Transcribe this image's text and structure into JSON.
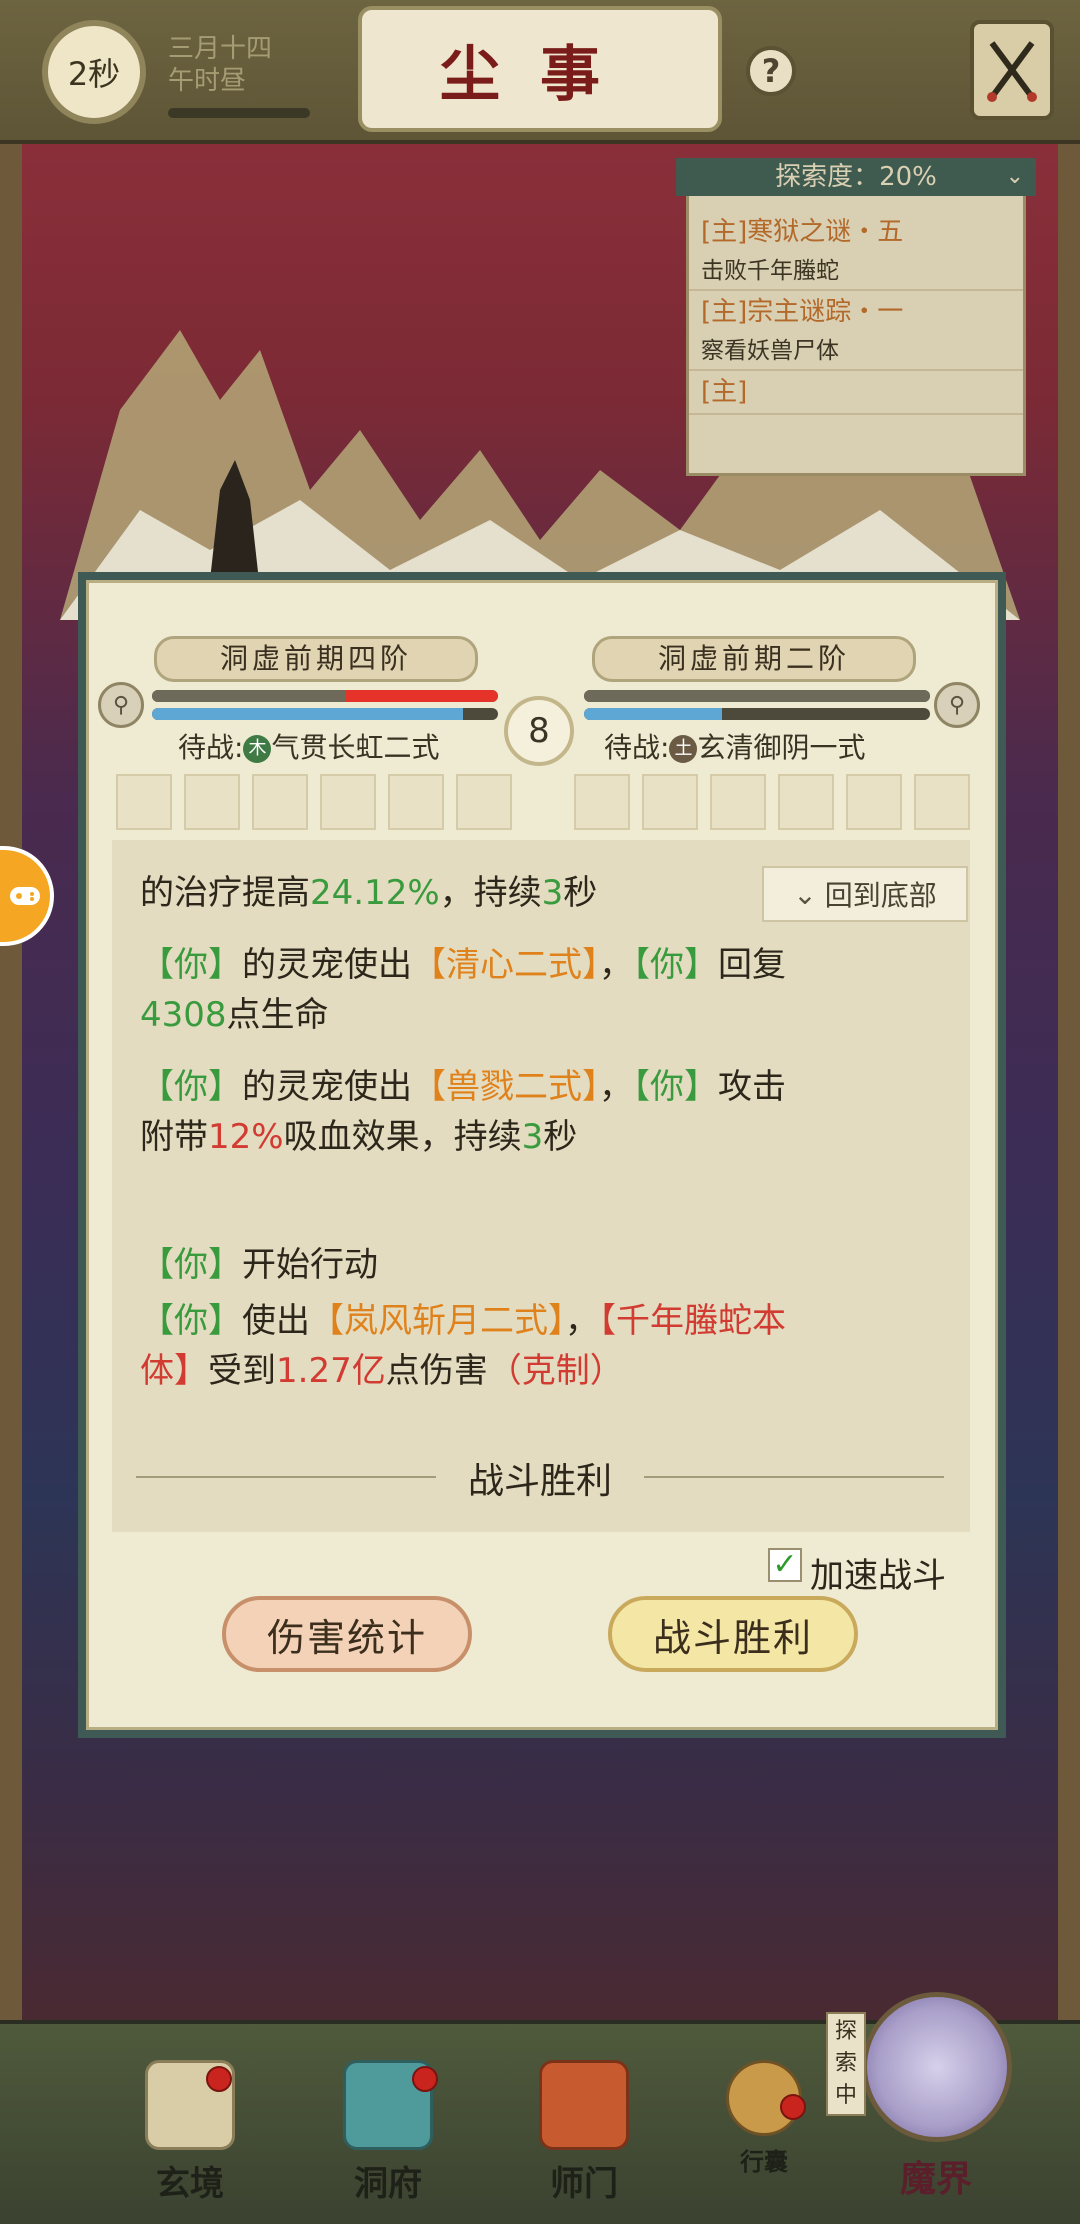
{
  "topbar": {
    "timer": "2秒",
    "date_line1": "三月十四",
    "date_line2": "午时昼",
    "title": "尘事",
    "help": "?",
    "close_icon": "crossed-swords-icon"
  },
  "quest_panel": {
    "header": "探索度：20%",
    "items": [
      {
        "title": "[主]寒狱之谜・五",
        "desc": "击败千年螣蛇"
      },
      {
        "title": "[主]宗主谜踪・一",
        "desc": "察看妖兽尸体"
      },
      {
        "title": "[主]",
        "desc": ""
      }
    ]
  },
  "battle": {
    "player_rank": "洞虚前期四阶",
    "enemy_rank": "洞虚前期二阶",
    "round": "8",
    "player_waiting_label": "待战",
    "player_element": "木",
    "player_waiting_skill": "气贯长虹二式",
    "enemy_waiting_label": "待战",
    "enemy_element": "土",
    "enemy_waiting_skill": "玄清御阴一式",
    "player_hp_fraction": 0.56,
    "player_hp_lost_fraction": 0.44,
    "player_mp_fraction": 0.9,
    "enemy_hp_fraction": 1.0,
    "enemy_mp_fraction": 0.4
  },
  "log": {
    "to_bottom": "回到底部",
    "l1a": "的治疗提高",
    "l1b": "24.12%",
    "l1c": "，持续",
    "l1d": "3",
    "l1e": "秒",
    "l2a": "【你】",
    "l2b": "的灵宠使出",
    "l2c": "【清心二式】",
    "l2d": "，",
    "l2e": "【你】",
    "l2f": "回复",
    "l2g": "4308",
    "l2h": "点生命",
    "l3a": "【你】",
    "l3b": "的灵宠使出",
    "l3c": "【兽戮二式】",
    "l3d": "，",
    "l3e": "【你】",
    "l3f": "攻击",
    "l3g": "附带",
    "l3h": "12%",
    "l3i": "吸血效果，持续",
    "l3j": "3",
    "l3k": "秒",
    "l4a": "【你】",
    "l4b": "开始行动",
    "l5a": "【你】",
    "l5b": "使出",
    "l5c": "【岚风斩月二式】",
    "l5d": "，",
    "l5e": "【千年螣蛇本",
    "l5f": "体】",
    "l5g": "受到",
    "l5h": "1.27亿",
    "l5i": "点伤害",
    "l5j": "（克制）",
    "victory": "战斗胜利"
  },
  "controls": {
    "speed_label": "加速战斗",
    "speed_checked": true,
    "damage_stats": "伤害统计",
    "battle_win": "战斗胜利"
  },
  "nav": {
    "items": [
      "玄境",
      "洞府",
      "师门",
      "行囊"
    ],
    "explore_tag": "探索中",
    "demon_realm": "魔界"
  },
  "colors": {
    "green_text": "#3a9b3e",
    "orange_text": "#e0821c",
    "red_text": "#d23b32"
  }
}
